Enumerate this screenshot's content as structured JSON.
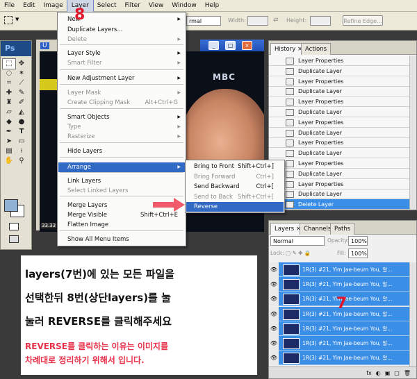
{
  "menubar": {
    "items": [
      "File",
      "Edit",
      "Image",
      "Layer",
      "Select",
      "Filter",
      "View",
      "Window",
      "Help"
    ],
    "active": "Layer"
  },
  "options": {
    "mode_value": "rmal",
    "width_label": "Width:",
    "height_label": "Height:",
    "refine_label": "Refine Edge..."
  },
  "toolbox": {
    "logo": "Ps"
  },
  "document": {
    "tab_text": "U",
    "zoom": "33.33",
    "watermark": "MBC",
    "close_glyph": "×",
    "min_glyph": "_",
    "max_glyph": "□"
  },
  "layer_menu": {
    "items": [
      {
        "label": "New",
        "arrow": "▶"
      },
      {
        "label": "Duplicate Layers..."
      },
      {
        "label": "Delete",
        "arrow": "▶",
        "disabled": true
      },
      {
        "label": "Layer Style",
        "arrow": "▶"
      },
      {
        "label": "Smart Filter",
        "arrow": "▶",
        "disabled": true
      },
      {
        "label": "New Adjustment Layer",
        "arrow": "▶"
      },
      {
        "label": "Layer Mask",
        "arrow": "▶",
        "disabled": true
      },
      {
        "label": "Create Clipping Mask",
        "shortcut": "Alt+Ctrl+G",
        "disabled": true
      },
      {
        "label": "Smart Objects",
        "arrow": "▶"
      },
      {
        "label": "Type",
        "arrow": "▶",
        "disabled": true
      },
      {
        "label": "Rasterize",
        "arrow": "▶",
        "disabled": true
      },
      {
        "label": "Hide Layers"
      },
      {
        "label": "Arrange",
        "arrow": "▶"
      },
      {
        "label": "Link Layers"
      },
      {
        "label": "Select Linked Layers",
        "disabled": true
      },
      {
        "label": "Merge Layers"
      },
      {
        "label": "Merge Visible",
        "shortcut": "Shift+Ctrl+E"
      },
      {
        "label": "Flatten Image"
      },
      {
        "label": "Show All Menu Items"
      }
    ]
  },
  "arrange_submenu": {
    "items": [
      {
        "label": "Bring to Front",
        "shortcut": "Shift+Ctrl+]"
      },
      {
        "label": "Bring Forward",
        "shortcut": "Ctrl+]",
        "disabled": true
      },
      {
        "label": "Send Backward",
        "shortcut": "Ctrl+["
      },
      {
        "label": "Send to Back",
        "shortcut": "Shift+Ctrl+[",
        "disabled": true
      },
      {
        "label": "Reverse"
      }
    ]
  },
  "history_panel": {
    "tabs": [
      "History",
      "Actions"
    ],
    "close_glyph": "×",
    "rows": [
      "Layer Properties",
      "Duplicate Layer",
      "Layer Properties",
      "Duplicate Layer",
      "Layer Properties",
      "Duplicate Layer",
      "Layer Properties",
      "Duplicate Layer",
      "Layer Properties",
      "Duplicate Layer",
      "Layer Properties",
      "Duplicate Layer",
      "Layer Properties",
      "Duplicate Layer",
      "Delete Layer"
    ]
  },
  "layers_panel": {
    "tabs": [
      "Layers",
      "Channels",
      "Paths"
    ],
    "close_glyph": "×",
    "blend_mode": "Normal",
    "opacity_label": "Opacity:",
    "opacity_value": "100%",
    "lock_label": "Lock:",
    "fill_label": "Fill:",
    "fill_value": "100%",
    "layer_rows": [
      "1R(3) #21, Yim Jae-beum  You, 알...",
      "1R(3) #21, Yim Jae-beum  You, 알...",
      "1R(3) #21, Yim Jae-beum  You, 알...",
      "1R(3) #21, Yim Jae-beum  You, 알...",
      "1R(3) #21, Yim Jae-beum  You, 알...",
      "1R(3) #21, Yim Jae-beum  You, 알...",
      "1R(3) #21, Yim Jae-beum  You, 알..."
    ],
    "bottom_icons": [
      "fx",
      "◐",
      "▣",
      "□",
      "🗑"
    ]
  },
  "annotations": {
    "step8": "8",
    "step7": "7",
    "line1": "layers(7번)에 있는 모든 파일을",
    "line2": "선택한뒤  8번(상단layers)를 눌",
    "line3": "눌러 REVERSE를 클릭해주세요",
    "red1": "REVERSE를 클릭하는 이유는 이미지를",
    "red2": "차례대로 정리하기 위해서 입니다."
  },
  "colors": {
    "highlight": "#316ac5",
    "selection": "#3b8ee6",
    "annotation_red": "#e8314a",
    "arrow": "#f05a6a"
  }
}
